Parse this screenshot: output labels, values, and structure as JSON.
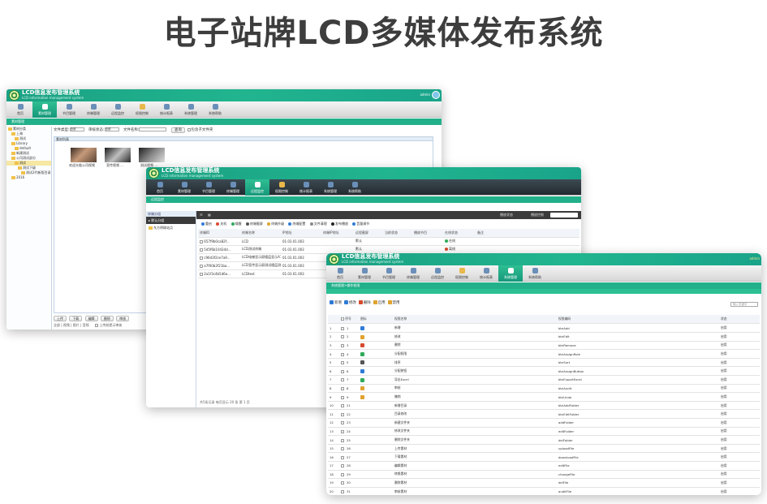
{
  "page": {
    "title": "电子站牌LCD多媒体发布系统"
  },
  "brand": {
    "name": "LCD信息发布管理系统",
    "subtitle": "LCD information management system",
    "color": "#1aa183"
  },
  "nav": [
    {
      "label": "首页",
      "icon": "home-icon"
    },
    {
      "label": "素材管理",
      "icon": "material-icon"
    },
    {
      "label": "节目管理",
      "icon": "program-icon"
    },
    {
      "label": "终端管理",
      "icon": "terminal-icon"
    },
    {
      "label": "远程监控",
      "icon": "monitor-icon"
    },
    {
      "label": "权限控制",
      "icon": "key-icon"
    },
    {
      "label": "统计报表",
      "icon": "report-icon"
    },
    {
      "label": "系统管理",
      "icon": "system-icon"
    },
    {
      "label": "系统帮助",
      "icon": "help-icon"
    }
  ],
  "window1": {
    "subbar": "素材管理",
    "filter": {
      "file_type": "文件类型:",
      "file_type_value": "全部",
      "audit_status": "审核状态:",
      "audit_value": "全部",
      "file_name": "文件名称:",
      "query": "查询",
      "include_sub": "包含子文件夹"
    },
    "grid_title": "素材列表",
    "tree": [
      "素材分类",
      "上海",
      "测试",
      "Library",
      "default",
      "新建测试",
      "公司测试部分",
      "测试",
      "测试下级",
      "测试2代新版目录",
      "2016"
    ],
    "thumbs": [
      {
        "label": "欢迎光临公司视频"
      },
      {
        "label": "宣传视频 ..."
      },
      {
        "label": "测试视频 ..."
      }
    ],
    "buttons": [
      "上传",
      "下载",
      "编辑",
      "删除",
      "审核"
    ],
    "footer": "全部 | 视频 | 图片 | 音频",
    "footer_check": "上传前提示审核"
  },
  "window2": {
    "subbar": "远程监控",
    "side_head": "终端分组",
    "groups": [
      "默认分组",
      "东方明珠站点"
    ],
    "dark_labels": [
      "播放状态",
      "播放控制"
    ],
    "toolbar": [
      "重启",
      "关机",
      "唤醒",
      "终端截屏",
      "终端升级",
      "终端配置",
      "文件清理",
      "发布播放",
      "音量调节"
    ],
    "columns": [
      "终端ID",
      "终端名称",
      "IP地址",
      "终端IP地址",
      "远程截屏",
      "当前状态",
      "播放节目",
      "在线状态",
      "备注"
    ],
    "rows": [
      {
        "id": "657f9b0ca82f...",
        "name": "LCD",
        "ip": "01.03.01.003",
        "area": "默认",
        "status": "在线"
      },
      {
        "id": "5d5f6b10434d...",
        "name": "LCD测试终端",
        "ip": "01.03.01.003",
        "area": "默认",
        "status": "离线"
      },
      {
        "id": "c96d3f2ce7a9...",
        "name": "LCD电梯显示屏楼层显示A17...",
        "ip": "01.03.01.003",
        "area": "默认",
        "status": "离线"
      },
      {
        "id": "a7f00b2f21ba...",
        "name": "LCD宣传显示屏测试楼层测试B...",
        "ip": "01.03.01.003",
        "area": "默认",
        "status": "离线"
      },
      {
        "id": "2a1f3c4b5d6e...",
        "name": "LCDtest",
        "ip": "01.03.01.003",
        "area": "默认",
        "status": "离线"
      }
    ],
    "pager": "共5条记录 每页显示 20 条 第 1 页"
  },
  "window3": {
    "subbar": "系统管理>操作权限",
    "toolbar": [
      "新增",
      "修改",
      "删除",
      "启用",
      "禁用"
    ],
    "search_placeholder": "输入关键字",
    "columns": [
      "序号",
      "图标",
      "权限名称",
      "权限编码",
      "状态"
    ],
    "rows": [
      {
        "no": "1",
        "seq": "1",
        "name": "新增",
        "code": "btnAdd",
        "state": "启用"
      },
      {
        "no": "2",
        "seq": "2",
        "name": "修改",
        "code": "btnEdit",
        "state": "启用"
      },
      {
        "no": "3",
        "seq": "3",
        "name": "删除",
        "code": "btnRemove",
        "state": "启用"
      },
      {
        "no": "4",
        "seq": "4",
        "name": "分配权限",
        "code": "btnAssignRole",
        "state": "启用"
      },
      {
        "no": "5",
        "seq": "5",
        "name": "排序",
        "code": "btnSort",
        "state": "启用"
      },
      {
        "no": "6",
        "seq": "6",
        "name": "分配按钮",
        "code": "btnAssignButton",
        "state": "启用"
      },
      {
        "no": "7",
        "seq": "7",
        "name": "导出Excel",
        "code": "btnExportExcel",
        "state": "启用"
      },
      {
        "no": "8",
        "seq": "8",
        "name": "审核",
        "code": "btnAudit",
        "state": "启用"
      },
      {
        "no": "9",
        "seq": "9",
        "name": "撤销",
        "code": "btnUndo",
        "state": "启用"
      },
      {
        "no": "10",
        "seq": "21",
        "name": "新增目录",
        "code": "btnAddFolder",
        "state": "启用"
      },
      {
        "no": "11",
        "seq": "22",
        "name": "目录修改",
        "code": "btnEditFolder",
        "state": "启用"
      },
      {
        "no": "12",
        "seq": "23",
        "name": "新建文件夹",
        "code": "addFolder",
        "state": "启用"
      },
      {
        "no": "13",
        "seq": "24",
        "name": "修改文件夹",
        "code": "editFolder",
        "state": "启用"
      },
      {
        "no": "14",
        "seq": "25",
        "name": "删除文件夹",
        "code": "delFolder",
        "state": "启用"
      },
      {
        "no": "15",
        "seq": "26",
        "name": "上传素材",
        "code": "uploadFile",
        "state": "启用"
      },
      {
        "no": "16",
        "seq": "27",
        "name": "下载素材",
        "code": "downloadFile",
        "state": "启用"
      },
      {
        "no": "17",
        "seq": "28",
        "name": "编辑素材",
        "code": "editFile",
        "state": "启用"
      },
      {
        "no": "18",
        "seq": "29",
        "name": "转换素材",
        "code": "changeFile",
        "state": "启用"
      },
      {
        "no": "19",
        "seq": "30",
        "name": "删除素材",
        "code": "delFile",
        "state": "启用"
      },
      {
        "no": "20",
        "seq": "31",
        "name": "审核素材",
        "code": "auditFile",
        "state": "启用"
      }
    ]
  }
}
